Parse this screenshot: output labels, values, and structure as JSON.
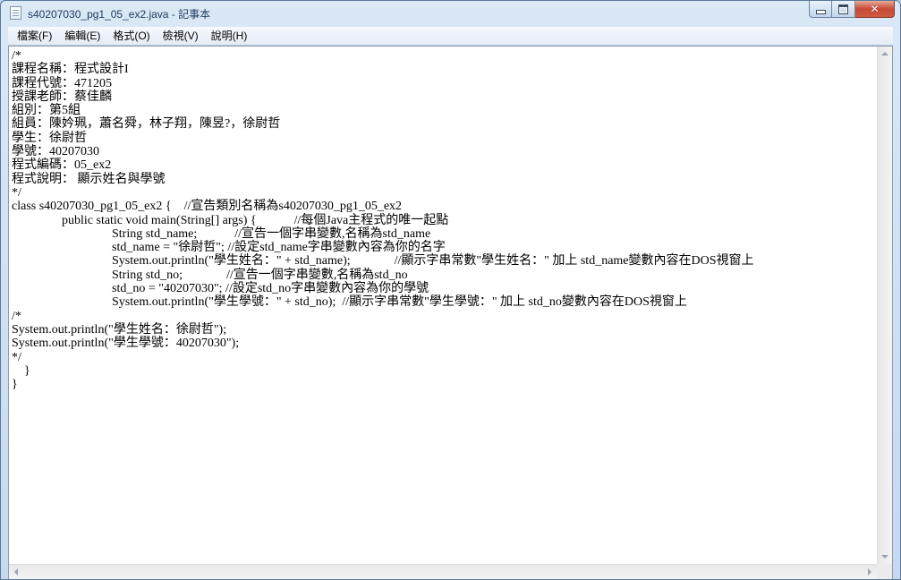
{
  "window": {
    "title": "s40207030_pg1_05_ex2.java - 記事本"
  },
  "menu": {
    "items": [
      {
        "label": "檔案(F)"
      },
      {
        "label": "編輯(E)"
      },
      {
        "label": "格式(O)"
      },
      {
        "label": "檢視(V)"
      },
      {
        "label": "說明(H)"
      }
    ]
  },
  "editor": {
    "lines": [
      "/*",
      "課程名稱：程式設計I",
      "課程代號：471205",
      "授課老師：蔡佳麟",
      "組別：第5組",
      "組員：陳妗珮，蕭名舜，林子翔，陳昱?，徐尉哲",
      "學生：徐尉哲",
      "學號：40207030",
      "程式編碼：05_ex2",
      "程式說明： 顯示姓名與學號",
      "*/",
      "class s40207030_pg1_05_ex2 {    //宣告類別名稱為s40207030_pg1_05_ex2",
      "                public static void main(String[] args) {            //每個Java主程式的唯一起點",
      "                                String std_name;            //宣告一個字串變數,名稱為std_name",
      "                                std_name = \"徐尉哲\"; //設定std_name字串變數內容為你的名字",
      "                                System.out.println(\"學生姓名：\" + std_name);              //顯示字串常數\"學生姓名：\" 加上 std_name變數內容在DOS視窗上",
      "                                String std_no;              //宣告一個字串變數,名稱為std_no",
      "                                std_no = \"40207030\"; //設定std_no字串變數內容為你的學號",
      "                                System.out.println(\"學生學號：\" + std_no);  //顯示字串常數\"學生學號：\" 加上 std_no變數內容在DOS視窗上",
      "/*",
      "System.out.println(\"學生姓名：徐尉哲\");",
      "System.out.println(\"學生學號：40207030\");",
      "*/",
      "    }",
      "}"
    ]
  },
  "icons": {
    "app": "notepad-icon",
    "minimize": "minimize-icon",
    "maximize": "maximize-icon",
    "close": "close-icon"
  },
  "colors": {
    "close_button": "#c74a34",
    "titlebar": "#c6d9ef"
  }
}
